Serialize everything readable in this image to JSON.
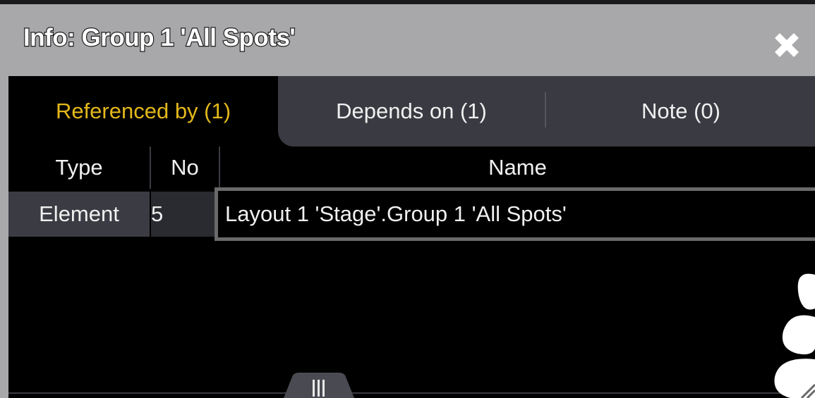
{
  "window": {
    "title": "Info: Group 1 'All Spots'"
  },
  "tabs": [
    {
      "label": "Referenced by (1)",
      "active": true
    },
    {
      "label": "Depends on (1)",
      "active": false
    },
    {
      "label": "Note (0)",
      "active": false
    }
  ],
  "table": {
    "columns": [
      "Type",
      "No",
      "Name"
    ],
    "rows": [
      {
        "type": "Element",
        "no": "5",
        "name": "Layout 1 'Stage'.Group 1 'All Spots'"
      }
    ]
  },
  "colors": {
    "titlebar": "#a8a8ab",
    "active_tab_text": "#e3b81b",
    "inactive_tab_bg": "#3a3b42",
    "row_bg": "#3b3c43",
    "selected_cell_border": "#6a6a6a"
  },
  "icons": {
    "close": "close-icon",
    "scroll_handle": "grip-lines-icon",
    "resize": "resize-grip-icon"
  }
}
